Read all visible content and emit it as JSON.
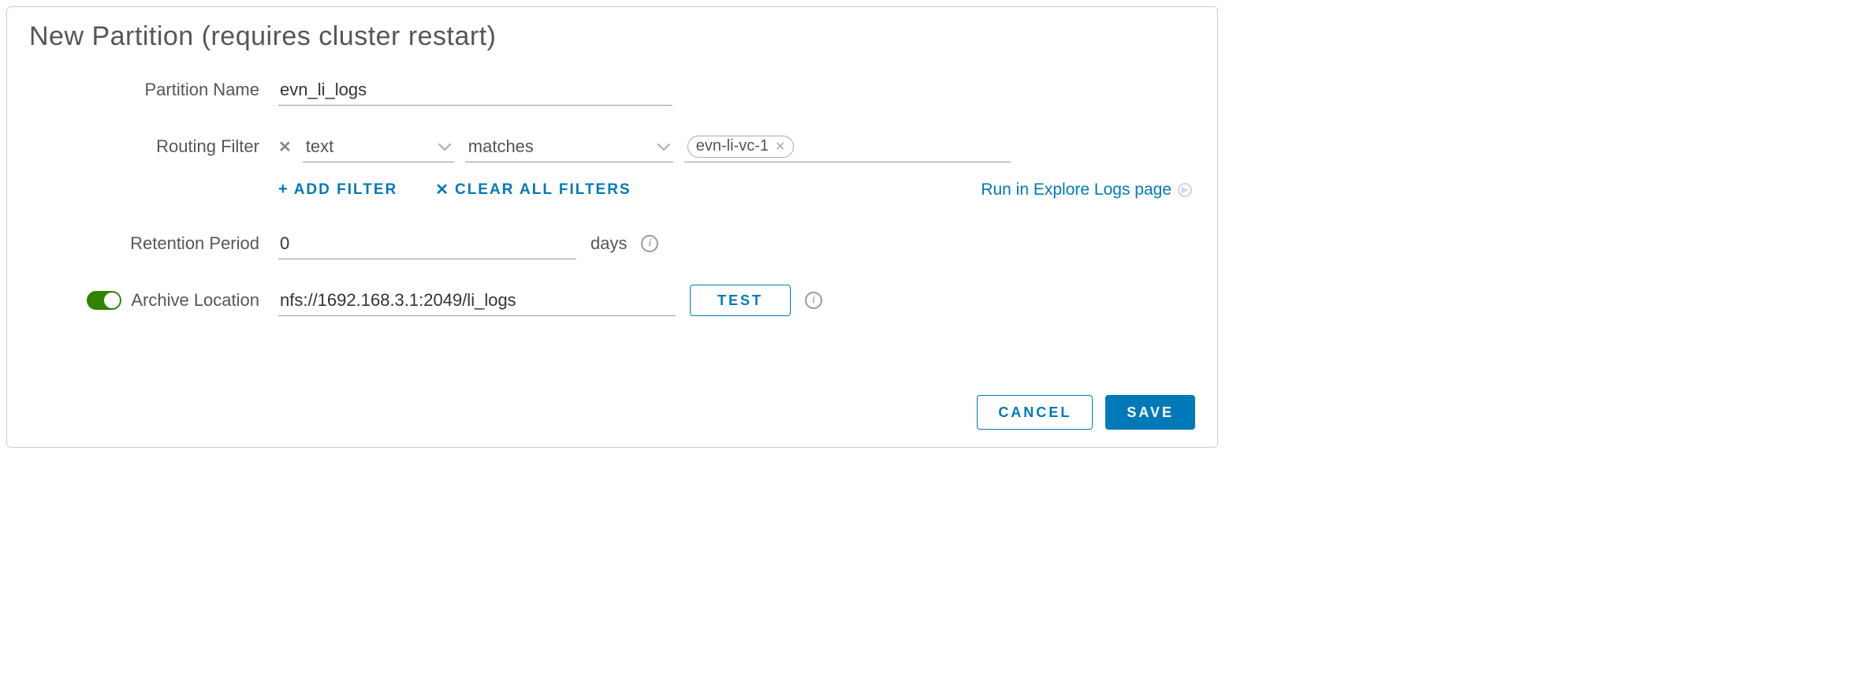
{
  "title": "New Partition (requires cluster restart)",
  "labels": {
    "partition_name": "Partition Name",
    "routing_filter": "Routing Filter",
    "retention_period": "Retention Period",
    "archive_location": "Archive Location"
  },
  "partition_name": {
    "value": "evn_li_logs"
  },
  "routing_filter": {
    "field_selected": "text",
    "operator_selected": "matches",
    "chip_value": "evn-li-vc-1"
  },
  "filter_actions": {
    "add_filter": "ADD FILTER",
    "clear_all": "CLEAR ALL FILTERS",
    "run_link": "Run in Explore Logs page"
  },
  "retention": {
    "value": "0",
    "unit": "days"
  },
  "archive": {
    "enabled": true,
    "value": "nfs://1692.168.3.1:2049/li_logs",
    "test_label": "TEST"
  },
  "buttons": {
    "cancel": "CANCEL",
    "save": "SAVE"
  }
}
